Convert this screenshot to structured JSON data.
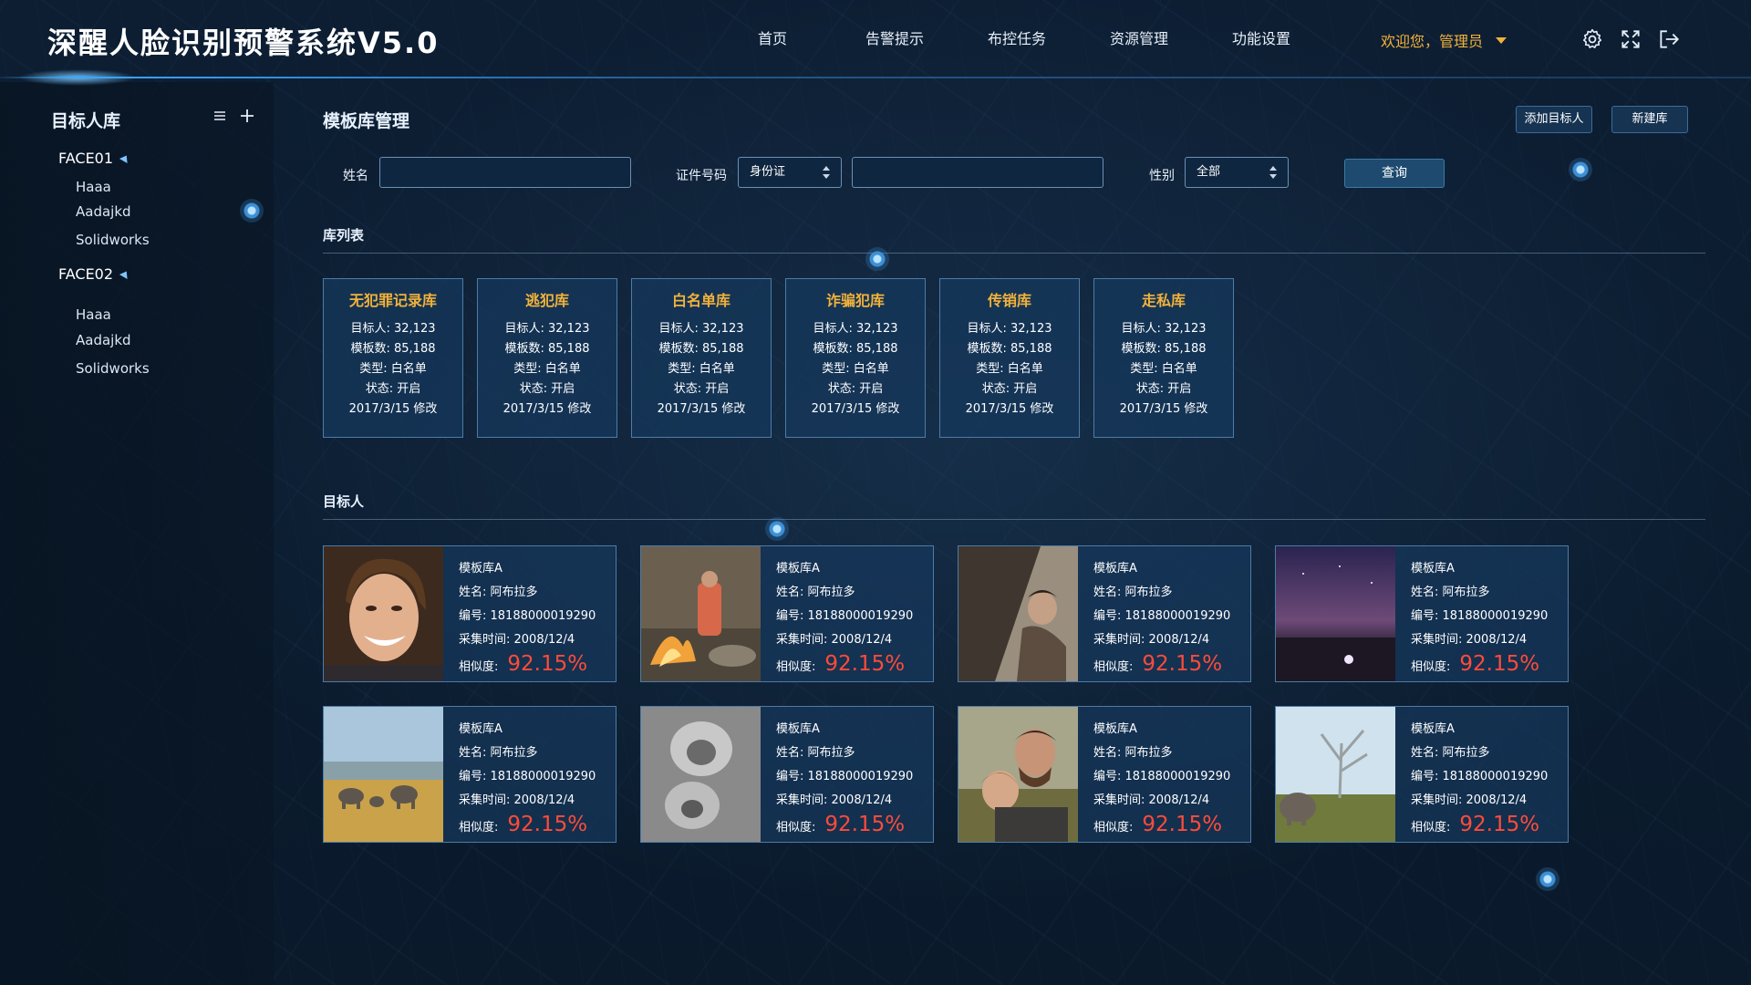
{
  "header": {
    "title": "深醒人脸识别预警系统V5.0",
    "nav": [
      "首页",
      "告警提示",
      "布控任务",
      "资源管理",
      "功能设置"
    ],
    "welcome": "欢迎您，管理员",
    "icons": [
      "gear-icon",
      "fullscreen-icon",
      "logout-icon"
    ]
  },
  "sidebar": {
    "title": "目标人库",
    "groups": [
      {
        "label": "FACE01",
        "items": [
          "Haaa",
          "Aadajkd",
          "Solidworks"
        ]
      },
      {
        "label": "FACE02",
        "items": [
          "Haaa",
          "Aadajkd",
          "Solidworks"
        ]
      }
    ]
  },
  "main": {
    "title": "模板库管理",
    "add_target_label": "添加目标人",
    "new_lib_label": "新建库",
    "form": {
      "name_label": "姓名",
      "name_value": "",
      "id_label": "证件号码",
      "id_type": "身份证",
      "id_value": "",
      "gender_label": "性别",
      "gender_value": "全部",
      "query_label": "查询"
    },
    "lib_section_title": "库列表",
    "target_section_title": "目标人"
  },
  "libraries": [
    {
      "name": "无犯罪记录库",
      "targets": "目标人: 32,123",
      "templates": "模板数: 85,188",
      "type": "类型: 白名单",
      "status": "状态: 开启",
      "modified": "2017/3/15 修改"
    },
    {
      "name": "逃犯库",
      "targets": "目标人: 32,123",
      "templates": "模板数: 85,188",
      "type": "类型: 白名单",
      "status": "状态: 开启",
      "modified": "2017/3/15 修改"
    },
    {
      "name": "白名单库",
      "targets": "目标人: 32,123",
      "templates": "模板数: 85,188",
      "type": "类型: 白名单",
      "status": "状态: 开启",
      "modified": "2017/3/15 修改"
    },
    {
      "name": "诈骗犯库",
      "targets": "目标人: 32,123",
      "templates": "模板数: 85,188",
      "type": "类型: 白名单",
      "status": "状态: 开启",
      "modified": "2017/3/15 修改"
    },
    {
      "name": "传销库",
      "targets": "目标人: 32,123",
      "templates": "模板数: 85,188",
      "type": "类型: 白名单",
      "status": "状态: 开启",
      "modified": "2017/3/15 修改"
    },
    {
      "name": "走私库",
      "targets": "目标人: 32,123",
      "templates": "模板数: 85,188",
      "type": "类型: 白名单",
      "status": "状态: 开启",
      "modified": "2017/3/15 修改"
    }
  ],
  "targets": [
    {
      "lib": "模板库A",
      "name": "姓名: 阿布拉多",
      "code": "编号: 18188000019290",
      "time": "采集时间: 2008/12/4",
      "sim_label": "相似度:",
      "sim": "92.15%",
      "photo": "smiling-woman"
    },
    {
      "lib": "模板库A",
      "name": "姓名: 阿布拉多",
      "code": "编号: 18188000019290",
      "time": "采集时间: 2008/12/4",
      "sim_label": "相似度:",
      "sim": "92.15%",
      "photo": "campfire-person"
    },
    {
      "lib": "模板库A",
      "name": "姓名: 阿布拉多",
      "code": "编号: 18188000019290",
      "time": "采集时间: 2008/12/4",
      "sim_label": "相似度:",
      "sim": "92.15%",
      "photo": "person-in-tent"
    },
    {
      "lib": "模板库A",
      "name": "姓名: 阿布拉多",
      "code": "编号: 18188000019290",
      "time": "采集时间: 2008/12/4",
      "sim_label": "相似度:",
      "sim": "92.15%",
      "photo": "night-sky"
    },
    {
      "lib": "模板库A",
      "name": "姓名: 阿布拉多",
      "code": "编号: 18188000019290",
      "time": "采集时间: 2008/12/4",
      "sim_label": "相似度:",
      "sim": "92.15%",
      "photo": "elephants-savanna"
    },
    {
      "lib": "模板库A",
      "name": "姓名: 阿布拉多",
      "code": "编号: 18188000019290",
      "time": "采集时间: 2008/12/4",
      "sim_label": "相似度:",
      "sim": "92.15%",
      "photo": "monkeys-bw"
    },
    {
      "lib": "模板库A",
      "name": "姓名: 阿布拉多",
      "code": "编号: 18188000019290",
      "time": "采集时间: 2008/12/4",
      "sim_label": "相似度:",
      "sim": "92.15%",
      "photo": "father-and-child"
    },
    {
      "lib": "模板库A",
      "name": "姓名: 阿布拉多",
      "code": "编号: 18188000019290",
      "time": "采集时间: 2008/12/4",
      "sim_label": "相似度:",
      "sim": "92.15%",
      "photo": "elephant-tree"
    }
  ],
  "colors": {
    "accent": "#f2b23a",
    "similarity": "#ff4b3a",
    "card_bg": "#16385c",
    "card_border": "#4d7ba6"
  }
}
